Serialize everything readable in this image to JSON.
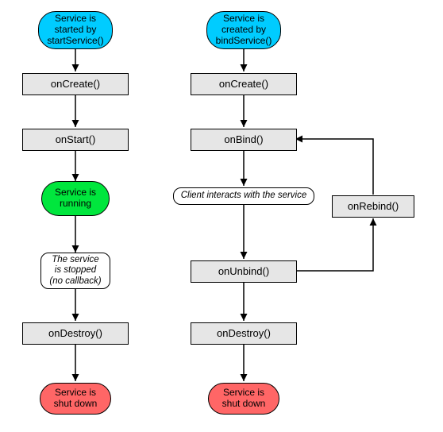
{
  "left": {
    "start": "Service is\nstarted by\nstartService()",
    "onCreate": "onCreate()",
    "onStart": "onStart()",
    "running": "Service is\nrunning",
    "stopNote": "The service\nis stopped\n(no callback)",
    "onDestroy": "onDestroy()",
    "shutdown": "Service is\nshut down"
  },
  "right": {
    "start": "Service is\ncreated by\nbindService()",
    "onCreate": "onCreate()",
    "onBind": "onBind()",
    "interact": "Client interacts with the service",
    "onUnbind": "onUnbind()",
    "onDestroy": "onDestroy()",
    "shutdown": "Service is\nshut down",
    "onRebind": "onRebind()"
  },
  "colors": {
    "cyan": "#00ccff",
    "green": "#00e63d",
    "red": "#ff6666",
    "gray": "#e6e6e6"
  }
}
